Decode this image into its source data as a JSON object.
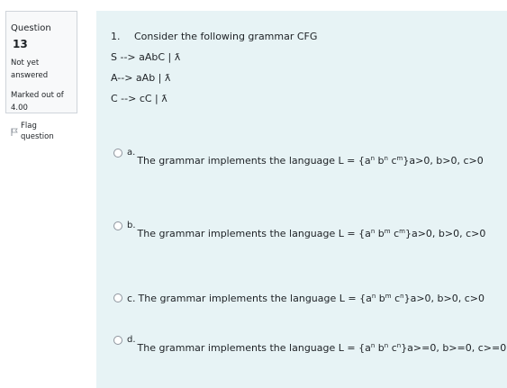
{
  "info": {
    "question_label": "Question",
    "question_number": "13",
    "state_line1": "Not yet",
    "state_line2": "answered",
    "grade_line1": "Marked out of",
    "grade_line2": "4.00",
    "flag_label": "Flag question",
    "flag_icon": "flag-icon"
  },
  "question": {
    "number": "1.",
    "prompt": "Consider the following grammar CFG",
    "rules": [
      "S --> aAbC | ƛ",
      "A--> aAb | ƛ",
      "C --> cC | ƛ"
    ]
  },
  "answers": [
    {
      "letter": "a.",
      "prefix": "The grammar implements the language L = {a",
      "sup1": "n",
      "mid1": " b",
      "sup2": "n",
      "mid2": " c",
      "sup3": "m",
      "suffix": "}a>0, b>0, c>0"
    },
    {
      "letter": "b.",
      "prefix": "The grammar implements the language L = {a",
      "sup1": "n",
      "mid1": " b",
      "sup2": "m",
      "mid2": " c",
      "sup3": "m",
      "suffix": "}a>0, b>0, c>0"
    },
    {
      "letter": "c.",
      "prefix": "The grammar implements the language L = {a",
      "sup1": "n",
      "mid1": " b",
      "sup2": "m",
      "mid2": " c",
      "sup3": "n",
      "suffix": "}a>0, b>0, c>0"
    },
    {
      "letter": "d.",
      "prefix": "The grammar implements the language L = {a",
      "sup1": "n",
      "mid1": " b",
      "sup2": "n",
      "mid2": " c",
      "sup3": "n",
      "suffix": "}a>=0, b>=0, c>=0"
    }
  ]
}
